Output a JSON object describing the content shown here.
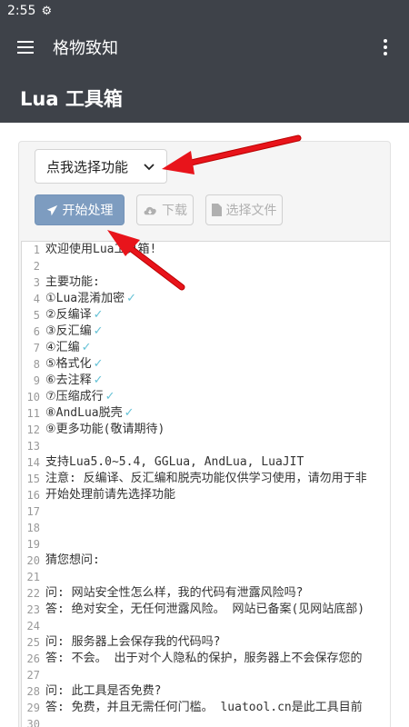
{
  "status": {
    "time": "2:55"
  },
  "appbar": {
    "title": "格物致知"
  },
  "header": {
    "title": "Lua 工具箱"
  },
  "toolbar": {
    "dropdown_label": "点我选择功能",
    "start_label": "开始处理",
    "download_label": "下载",
    "file_label": "选择文件"
  },
  "editor": {
    "lines": [
      {
        "n": "1",
        "text": "欢迎使用Lua工具箱!"
      },
      {
        "n": "2",
        "text": ""
      },
      {
        "n": "3",
        "text": "主要功能:"
      },
      {
        "n": "4",
        "text": "①Lua混淆加密",
        "check": true
      },
      {
        "n": "5",
        "text": "②反编译",
        "check": true
      },
      {
        "n": "6",
        "text": "③反汇编",
        "check": true
      },
      {
        "n": "7",
        "text": "④汇编",
        "check": true
      },
      {
        "n": "8",
        "text": "⑤格式化",
        "check": true
      },
      {
        "n": "9",
        "text": "⑥去注释",
        "check": true
      },
      {
        "n": "10",
        "text": "⑦压缩成行",
        "check": true
      },
      {
        "n": "11",
        "text": "⑧AndLua脱壳",
        "check": true
      },
      {
        "n": "12",
        "text": "⑨更多功能(敬请期待)"
      },
      {
        "n": "13",
        "text": ""
      },
      {
        "n": "14",
        "text": "支持Lua5.0~5.4, GGLua, AndLua, LuaJIT"
      },
      {
        "n": "15",
        "text": "注意: 反编译、反汇编和脱壳功能仅供学习使用，请勿用于非"
      },
      {
        "n": "16",
        "text": "开始处理前请先选择功能"
      },
      {
        "n": "17",
        "text": ""
      },
      {
        "n": "18",
        "text": ""
      },
      {
        "n": "19",
        "text": ""
      },
      {
        "n": "20",
        "text": "猜您想问:"
      },
      {
        "n": "21",
        "text": ""
      },
      {
        "n": "22",
        "text": "问: 网站安全性怎么样，我的代码有泄露风险吗?"
      },
      {
        "n": "23",
        "text": "答: 绝对安全，无任何泄露风险。 网站已备案(见网站底部)"
      },
      {
        "n": "24",
        "text": ""
      },
      {
        "n": "25",
        "text": "问: 服务器上会保存我的代码吗?"
      },
      {
        "n": "26",
        "text": "答: 不会。 出于对个人隐私的保护，服务器上不会保存您的"
      },
      {
        "n": "27",
        "text": ""
      },
      {
        "n": "28",
        "text": "问: 此工具是否免费?"
      },
      {
        "n": "29",
        "text": "答: 免费，并且无需任何门槛。 luatool.cn是此工具目前"
      },
      {
        "n": "30",
        "text": ""
      }
    ]
  },
  "colors": {
    "bar": "#3e4249",
    "primary_btn": "#7d9cc0",
    "check": "#66c2d6",
    "annotation_arrow": "#e8141b"
  }
}
